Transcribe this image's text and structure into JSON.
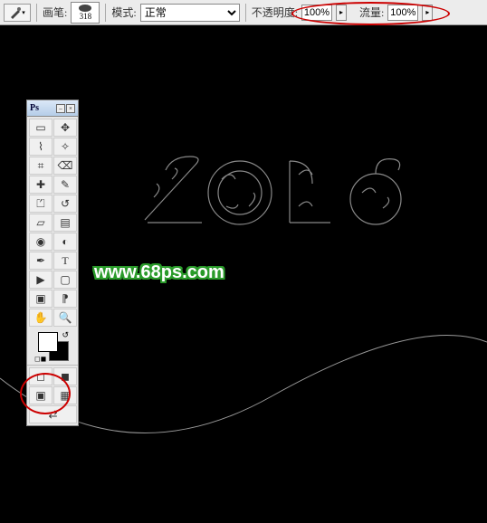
{
  "toolbar": {
    "brush_label": "画笔:",
    "brush_size": "318",
    "mode_label": "模式:",
    "mode_value": "正常",
    "opacity_label": "不透明度:",
    "opacity_value": "100%",
    "flow_label": "流量:",
    "flow_value": "100%"
  },
  "tools_panel": {
    "title": "Ps",
    "tools": [
      "rect-marquee-icon",
      "move-icon",
      "lasso-icon",
      "magic-wand-icon",
      "crop-icon",
      "slice-icon",
      "healing-icon",
      "brush-icon",
      "stamp-icon",
      "history-brush-icon",
      "eraser-icon",
      "gradient-icon",
      "blur-icon",
      "dodge-icon",
      "pen-icon",
      "type-icon",
      "path-select-icon",
      "shape-icon",
      "notes-icon",
      "eyedropper-icon",
      "hand-icon",
      "zoom-icon"
    ],
    "fg_color": "#ffffff",
    "bg_color": "#000000"
  },
  "canvas": {
    "text_art": "2016",
    "watermark": "www.68ps.com"
  }
}
